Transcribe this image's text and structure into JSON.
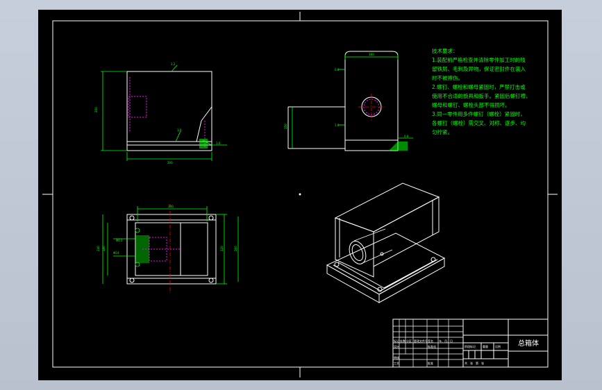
{
  "drawing": {
    "title_block": {
      "part_name": "总箱体",
      "col_headers": [
        "标记",
        "处数",
        "分区",
        "更改文件号",
        "签名",
        "年、月、日"
      ],
      "row_labels": [
        "设计",
        "审核",
        "工艺"
      ],
      "standardize": "标准化",
      "approve": "批准",
      "stage_header": "阶段标记",
      "weight_header": "重量",
      "scale_header": "比例",
      "sheet_info": "共　张　第　张"
    },
    "technical_requirements": {
      "heading": "技术要求：",
      "lines": [
        "1.装配前严格检查并清除零件加工时的残",
        "留铁屑、毛刺及异物，保证密封件在装入",
        "时不被擦伤。",
        "2.螺钉、螺栓和螺母紧固时，严禁打击或",
        "使用不合适的旋具和扳手。紧固后螺钉槽、",
        "螺母和螺钉、螺栓头部不得损坏。",
        "3.同一零件用多件螺钉（螺栓）紧固时，",
        "各螺钉（螺栓）需交叉、对称、逐步、均",
        "匀拧紧。"
      ]
    },
    "colors": {
      "outline": "#ffffff",
      "dimension": "#00ff00",
      "centerline": "#ff0000",
      "hidden": "#ff00ff",
      "background": "#000000"
    }
  }
}
